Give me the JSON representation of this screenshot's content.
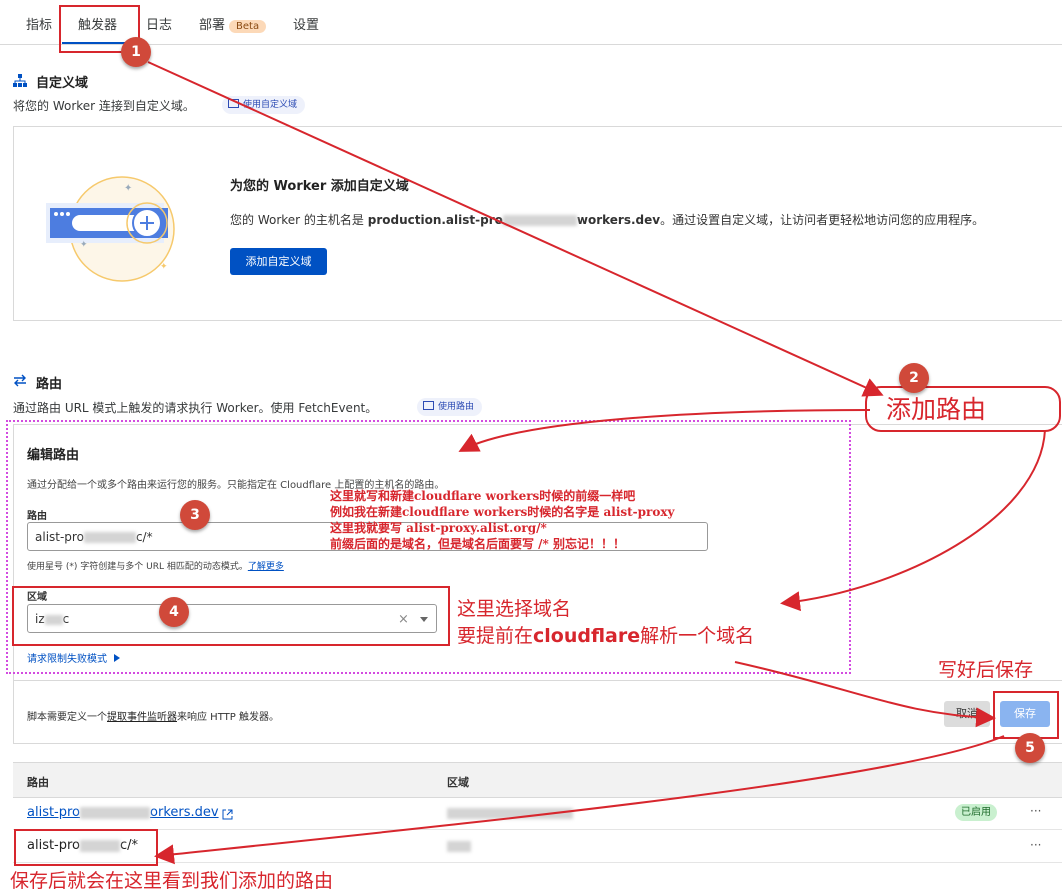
{
  "tabs": [
    {
      "label": "指标"
    },
    {
      "label": "触发器"
    },
    {
      "label": "日志"
    },
    {
      "label": "部署",
      "badge": "Beta"
    },
    {
      "label": "设置"
    }
  ],
  "custom_domain": {
    "title": "自定义域",
    "desc": "将您的 Worker 连接到自定义域。",
    "doc_link": "使用自定义域",
    "card_title": "为您的 Worker 添加自定义域",
    "host_prefix": "您的 Worker 的主机名是 ",
    "host_a": "production.alist-pro",
    "host_b": "workers.dev",
    "host_suffix": "。通过设置自定义域，让访问者更轻松地访问您的应用程序。",
    "add_button": "添加自定义域"
  },
  "routes": {
    "title": "路由",
    "desc": "通过路由 URL 模式上触发的请求执行 Worker。使用 FetchEvent。",
    "doc_link": "使用路由"
  },
  "edit_route": {
    "title": "编辑路由",
    "desc": "通过分配给一个或多个路由来运行您的服务。只能指定在 Cloudflare 上配置的主机名的路由。",
    "route_label": "路由",
    "route_value_a": "alist-pro",
    "route_value_b": "c/*",
    "hint": "使用星号 (*) 字符创建与多个 URL 相匹配的动态模式。",
    "learn_more": "了解更多",
    "zone_label": "区域",
    "zone_value_a": "iz",
    "zone_value_b": "c",
    "clear_symbol": "×",
    "fail_mode": "请求限制失败模式"
  },
  "footer_bar": {
    "text_a": "脚本需要定义一个",
    "link": "提取事件监听器",
    "text_b": "来响应 HTTP 触发器。",
    "cancel": "取消",
    "save": "保存"
  },
  "route_table": {
    "headers": [
      "路由",
      "区域"
    ],
    "rows": [
      {
        "route_a": "alist-pro",
        "route_b": "orkers.dev",
        "status": "已启用",
        "menu": "···"
      },
      {
        "route_a": "alist-pro",
        "route_b": "c/*",
        "status": "",
        "menu": "···"
      }
    ]
  },
  "annotations": {
    "badges": [
      "1",
      "2",
      "3",
      "4",
      "5"
    ],
    "add_route": "添加路由",
    "note_lines": [
      "这里就写和新建cloudflare workers时候的前缀一样吧",
      "例如我在新建cloudflare workers时候的名字是 alist-proxy",
      "这里我就要写 alist-proxy.alist.org/*",
      "前缀后面的是域名，但是域名后面要写  /* 别忘记！！！"
    ],
    "zone_note_1": "这里选择域名",
    "zone_note_2a": "要提前在",
    "zone_note_2b": "cloudflare",
    "zone_note_2c": "解析一个域名",
    "save_note": "写好后保存",
    "bottom_note": "保存后就会在这里看到我们添加的路由"
  },
  "colors": {
    "accent": "#0051c3",
    "annotation_red": "#d7262d",
    "badge_red": "#d0493a",
    "dotted_box": "#d34be0",
    "status_green_bg": "#c9f0cf"
  }
}
